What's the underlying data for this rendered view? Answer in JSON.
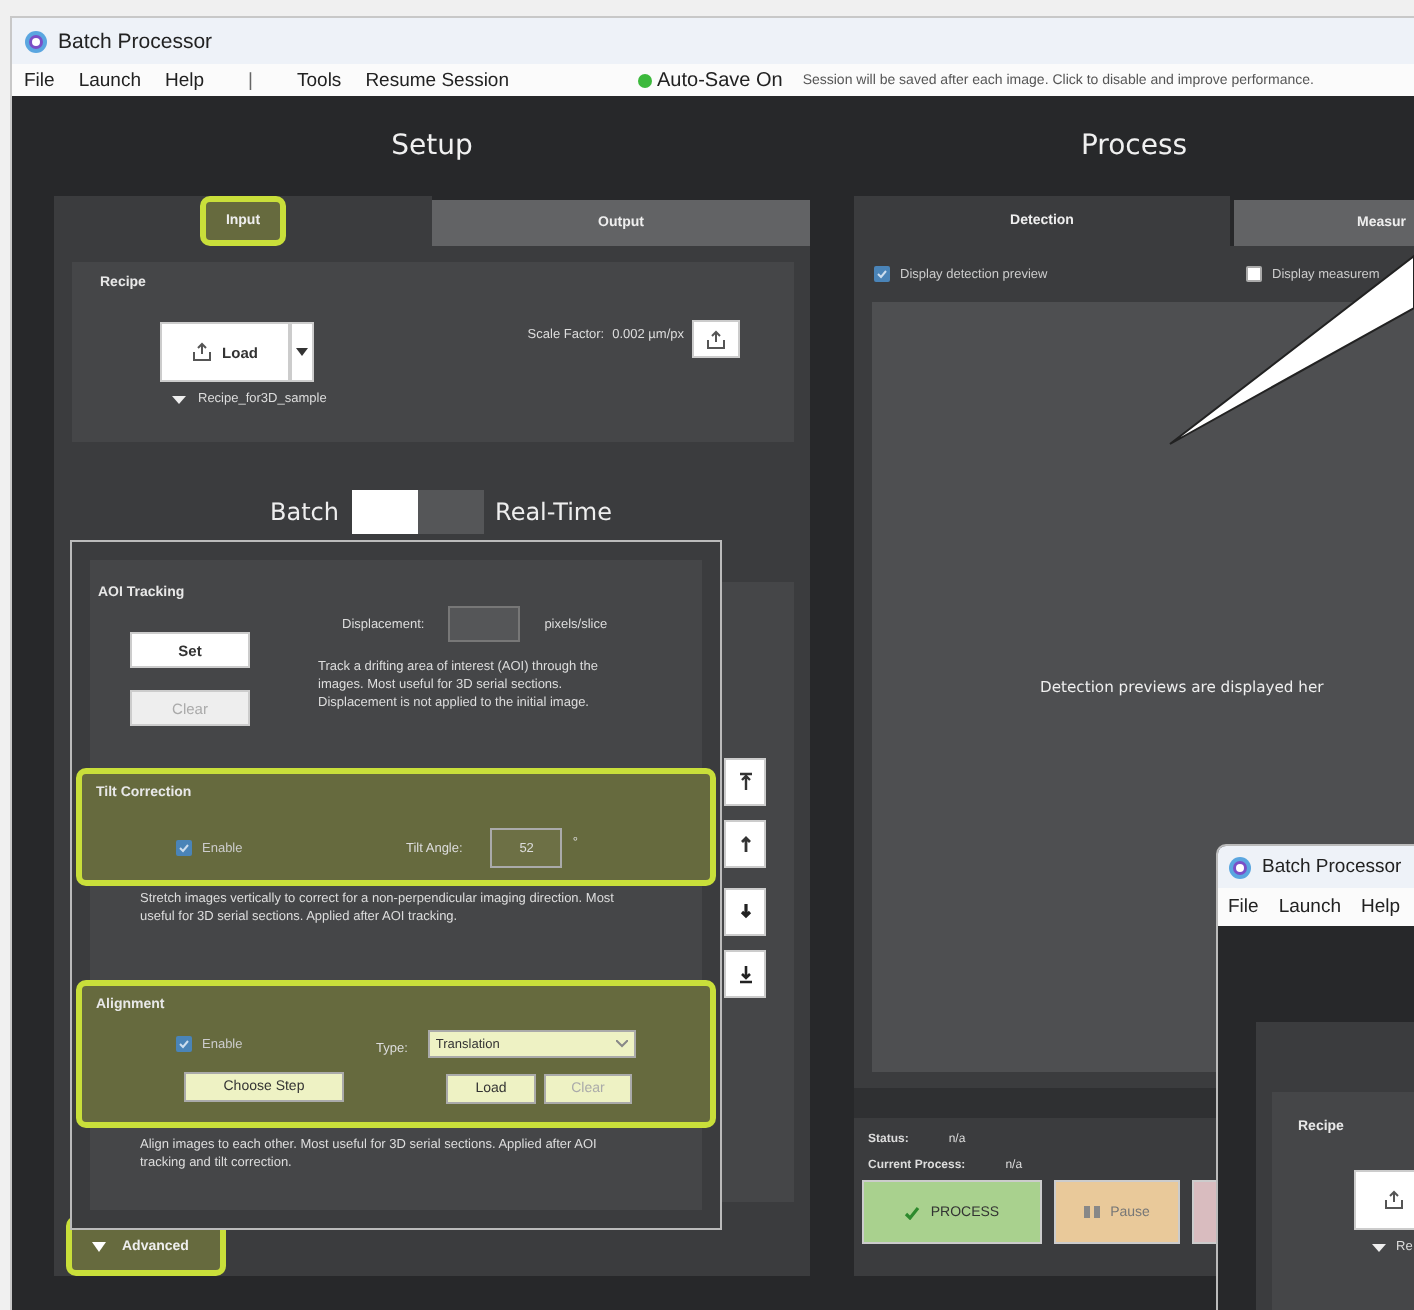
{
  "window": {
    "title": "Batch Processor"
  },
  "menu": [
    {
      "label": "File",
      "kind": "item"
    },
    {
      "label": "Launch",
      "kind": "item"
    },
    {
      "label": "Help",
      "kind": "item"
    },
    {
      "label": "|",
      "kind": "separator"
    },
    {
      "label": "Tools",
      "kind": "item"
    },
    {
      "label": "Resume Session",
      "kind": "item"
    }
  ],
  "autosave": {
    "label": "Auto-Save On",
    "on": true,
    "note": "Session will be saved after each image. Click to disable and improve performance."
  },
  "setup": {
    "title": "Setup",
    "tabs": [
      {
        "label": "Input",
        "selected": true,
        "highlighted": true
      },
      {
        "label": "Output",
        "selected": false,
        "highlighted": false
      }
    ],
    "recipe": {
      "title": "Recipe",
      "load_button": "Load",
      "recipe_name": "Recipe_for3D_sample",
      "scale_label": "Scale Factor:",
      "scale_value": "0.002 µm/px"
    },
    "mode_toggle": {
      "left_label": "Batch",
      "right_label": "Real-Time",
      "on": false
    },
    "advanced": {
      "label": "Advanced",
      "expanded": false,
      "highlighted": true
    }
  },
  "popup": {
    "aoi": {
      "title": "AOI Tracking",
      "displacement_label": "Displacement:",
      "unit": "pixels/slice",
      "set_button": {
        "label": "Set",
        "disabled": false
      },
      "clear_button": {
        "label": "Clear",
        "disabled": true
      },
      "description": "Track a drifting area of interest (AOI) through the images. Most useful for 3D serial sections. Displacement is not applied to the initial image."
    },
    "tilt": {
      "title": "Tilt Correction",
      "highlighted": true,
      "enable": {
        "label": "Enable",
        "checked": true
      },
      "angle_label": "Tilt Angle:",
      "angle_value": "52",
      "unit": "°",
      "description": "Stretch images vertically to correct for a non-perpendicular imaging direction. Most useful for 3D serial sections. Applied after AOI tracking."
    },
    "alignment": {
      "title": "Alignment",
      "highlighted": true,
      "enable": {
        "label": "Enable",
        "checked": true
      },
      "type_label": "Type:",
      "type_value": "Translation",
      "choose_button": {
        "label": "Choose Step",
        "disabled": false
      },
      "load_button": {
        "label": "Load",
        "disabled": false
      },
      "clear_button": {
        "label": "Clear",
        "disabled": true
      },
      "description": "Align images to each other. Most useful for 3D serial sections. Applied after AOI tracking and tilt correction."
    }
  },
  "process": {
    "title": "Process",
    "tabs": [
      {
        "label": "Detection",
        "selected": true
      },
      {
        "label": "Measur",
        "selected": false
      }
    ],
    "checkboxes": [
      {
        "label": "Display detection preview",
        "checked": true
      },
      {
        "label": "Display measurem",
        "checked": false
      }
    ],
    "preview_message": "Detection previews are displayed her",
    "status_label": "Status:",
    "status_value": "n/a",
    "current_label": "Current Process:",
    "current_value": "n/a",
    "buttons": [
      {
        "label": "PROCESS",
        "kind": "process"
      },
      {
        "label": "Pause",
        "kind": "pause"
      },
      {
        "kind": "stop"
      }
    ]
  },
  "second_window": {
    "title": "Batch Processor",
    "menu": [
      "File",
      "Launch",
      "Help"
    ],
    "recipe_title": "Recipe",
    "recipe_name": "Re"
  }
}
